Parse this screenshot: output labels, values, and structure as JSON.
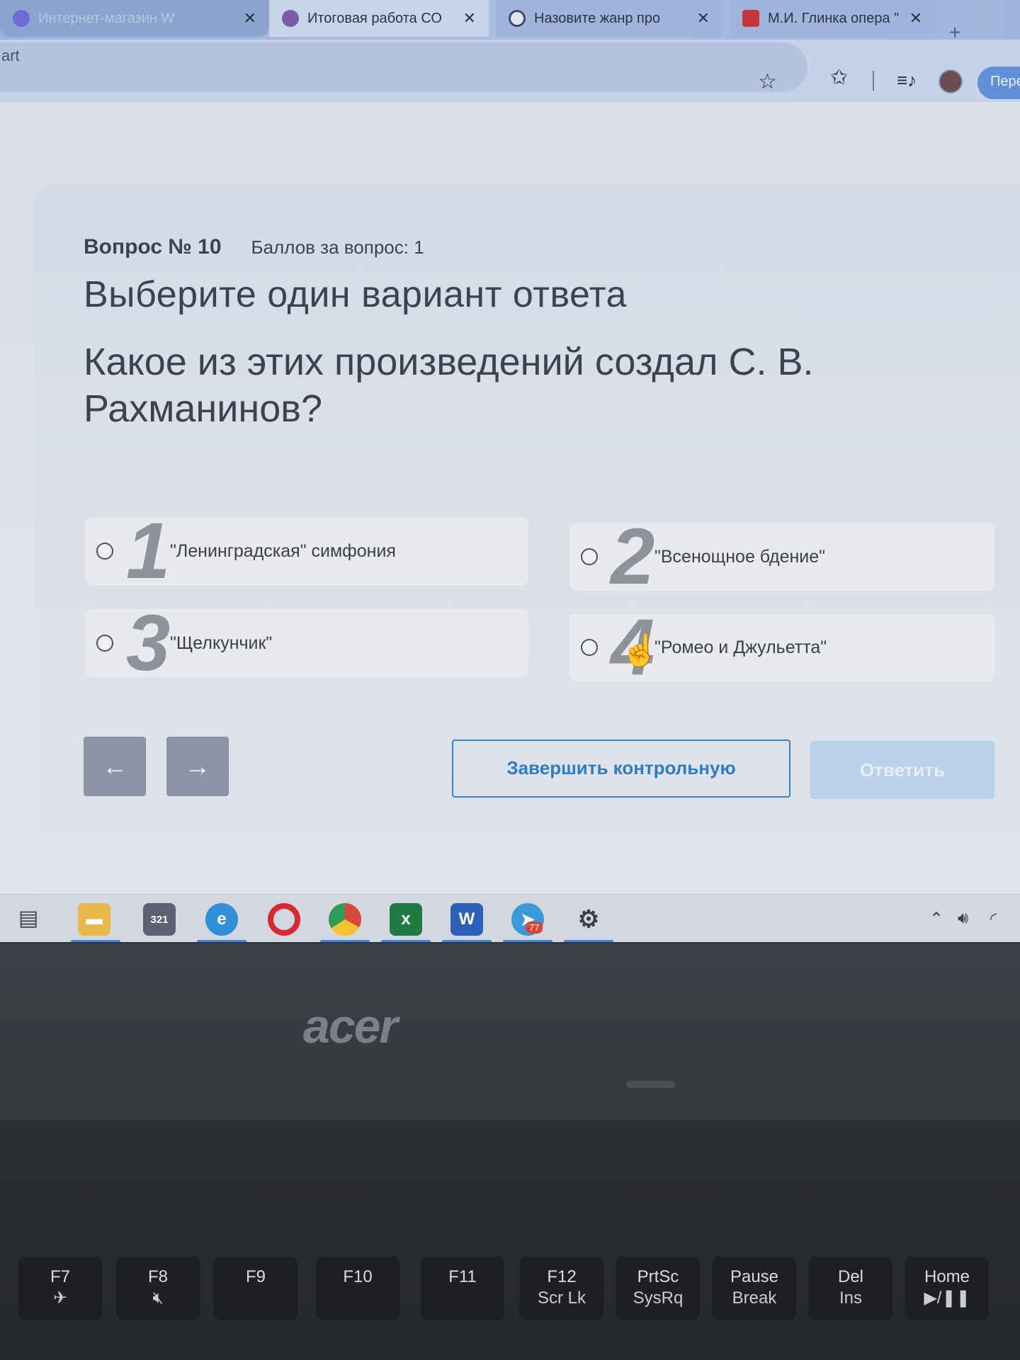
{
  "browser": {
    "tabs": [
      {
        "label": "Интернет-магазин W",
        "close": "✕",
        "icon_color": "#6f6bd6"
      },
      {
        "label": "Итоговая работа СО",
        "close": "✕",
        "icon_color": "#7b5aa6"
      },
      {
        "label": "Назовите жанр про",
        "close": "✕",
        "icon_color": "#e0e4ee"
      },
      {
        "label": "М.И. Глинка опера \"",
        "close": "✕",
        "icon_color": "#c0383c"
      }
    ],
    "new_tab": "+",
    "address_text": "art",
    "profile_button": "Пере"
  },
  "question": {
    "number_label": "Вопрос № 10",
    "points_label": "Баллов за вопрос: 1",
    "instruction": "Выберите один вариант ответа",
    "text": "Какое из этих произведений создал С. В. Рахманинов?"
  },
  "options": [
    {
      "num": "1",
      "text": "\"Ленинградская\" симфония"
    },
    {
      "num": "2",
      "text": "\"Всенощное бдение\""
    },
    {
      "num": "3",
      "text": "\"Щелкунчик\""
    },
    {
      "num": "4",
      "text": "\"Ромео и Джульетта\""
    }
  ],
  "buttons": {
    "prev": "←",
    "next": "→",
    "finish": "Завершить контрольную",
    "answer": "Ответить"
  },
  "taskbar": {
    "telegram_badge": "77",
    "calendar_label": "321"
  },
  "laptop": {
    "brand": "acer",
    "keys": [
      {
        "main": "F7",
        "sub": ""
      },
      {
        "main": "F8",
        "sub": ""
      },
      {
        "main": "F9",
        "sub": ""
      },
      {
        "main": "F10",
        "sub": ""
      },
      {
        "main": "F11",
        "sub": ""
      },
      {
        "main": "F12",
        "sub": "Scr Lk"
      },
      {
        "main": "PrtSc",
        "sub": "SysRq"
      },
      {
        "main": "Pause",
        "sub": "Break"
      },
      {
        "main": "Del",
        "sub": "Ins"
      },
      {
        "main": "Home",
        "sub": "▶/❚❚"
      }
    ]
  }
}
